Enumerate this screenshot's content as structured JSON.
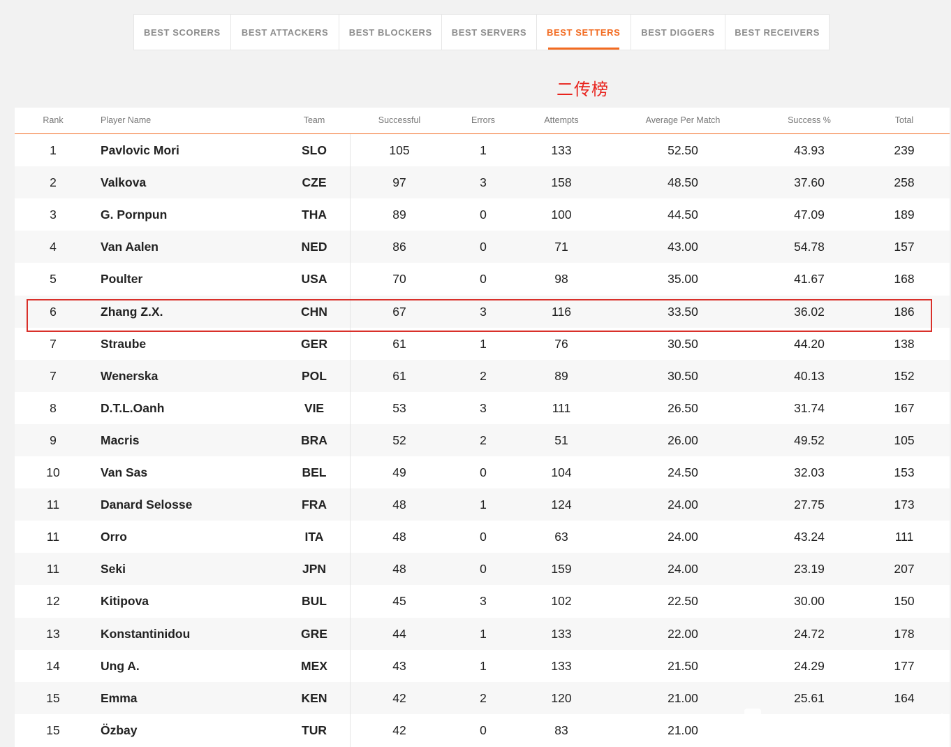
{
  "tabs": [
    {
      "label": "BEST SCORERS",
      "active": false
    },
    {
      "label": "BEST ATTACKERS",
      "active": false
    },
    {
      "label": "BEST BLOCKERS",
      "active": false
    },
    {
      "label": "BEST SERVERS",
      "active": false
    },
    {
      "label": "BEST SETTERS",
      "active": true
    },
    {
      "label": "BEST DIGGERS",
      "active": false
    },
    {
      "label": "BEST RECEIVERS",
      "active": false
    }
  ],
  "annotation": {
    "title": "二传榜",
    "highlighted_rank_row": "6",
    "highlight_color": "#d9302a"
  },
  "colors": {
    "accent": "#f26b21",
    "annotation_red": "#e8231d"
  },
  "table": {
    "headers": {
      "rank": "Rank",
      "name": "Player Name",
      "team": "Team",
      "successful": "Successful",
      "errors": "Errors",
      "attempts": "Attempts",
      "avg": "Average Per Match",
      "pct": "Success %",
      "total": "Total"
    },
    "rows": [
      {
        "rank": "1",
        "name": "Pavlovic Mori",
        "team": "SLO",
        "successful": "105",
        "errors": "1",
        "attempts": "133",
        "avg": "52.50",
        "pct": "43.93",
        "total": "239"
      },
      {
        "rank": "2",
        "name": "Valkova",
        "team": "CZE",
        "successful": "97",
        "errors": "3",
        "attempts": "158",
        "avg": "48.50",
        "pct": "37.60",
        "total": "258"
      },
      {
        "rank": "3",
        "name": "G. Pornpun",
        "team": "THA",
        "successful": "89",
        "errors": "0",
        "attempts": "100",
        "avg": "44.50",
        "pct": "47.09",
        "total": "189"
      },
      {
        "rank": "4",
        "name": "Van Aalen",
        "team": "NED",
        "successful": "86",
        "errors": "0",
        "attempts": "71",
        "avg": "43.00",
        "pct": "54.78",
        "total": "157"
      },
      {
        "rank": "5",
        "name": "Poulter",
        "team": "USA",
        "successful": "70",
        "errors": "0",
        "attempts": "98",
        "avg": "35.00",
        "pct": "41.67",
        "total": "168"
      },
      {
        "rank": "6",
        "name": "Zhang Z.X.",
        "team": "CHN",
        "successful": "67",
        "errors": "3",
        "attempts": "116",
        "avg": "33.50",
        "pct": "36.02",
        "total": "186"
      },
      {
        "rank": "7",
        "name": "Straube",
        "team": "GER",
        "successful": "61",
        "errors": "1",
        "attempts": "76",
        "avg": "30.50",
        "pct": "44.20",
        "total": "138"
      },
      {
        "rank": "7",
        "name": "Wenerska",
        "team": "POL",
        "successful": "61",
        "errors": "2",
        "attempts": "89",
        "avg": "30.50",
        "pct": "40.13",
        "total": "152"
      },
      {
        "rank": "8",
        "name": "D.T.L.Oanh",
        "team": "VIE",
        "successful": "53",
        "errors": "3",
        "attempts": "111",
        "avg": "26.50",
        "pct": "31.74",
        "total": "167"
      },
      {
        "rank": "9",
        "name": "Macris",
        "team": "BRA",
        "successful": "52",
        "errors": "2",
        "attempts": "51",
        "avg": "26.00",
        "pct": "49.52",
        "total": "105"
      },
      {
        "rank": "10",
        "name": "Van Sas",
        "team": "BEL",
        "successful": "49",
        "errors": "0",
        "attempts": "104",
        "avg": "24.50",
        "pct": "32.03",
        "total": "153"
      },
      {
        "rank": "11",
        "name": "Danard Selosse",
        "team": "FRA",
        "successful": "48",
        "errors": "1",
        "attempts": "124",
        "avg": "24.00",
        "pct": "27.75",
        "total": "173"
      },
      {
        "rank": "11",
        "name": "Orro",
        "team": "ITA",
        "successful": "48",
        "errors": "0",
        "attempts": "63",
        "avg": "24.00",
        "pct": "43.24",
        "total": "111"
      },
      {
        "rank": "11",
        "name": "Seki",
        "team": "JPN",
        "successful": "48",
        "errors": "0",
        "attempts": "159",
        "avg": "24.00",
        "pct": "23.19",
        "total": "207"
      },
      {
        "rank": "12",
        "name": "Kitipova",
        "team": "BUL",
        "successful": "45",
        "errors": "3",
        "attempts": "102",
        "avg": "22.50",
        "pct": "30.00",
        "total": "150"
      },
      {
        "rank": "13",
        "name": "Konstantinidou",
        "team": "GRE",
        "successful": "44",
        "errors": "1",
        "attempts": "133",
        "avg": "22.00",
        "pct": "24.72",
        "total": "178"
      },
      {
        "rank": "14",
        "name": "Ung A.",
        "team": "MEX",
        "successful": "43",
        "errors": "1",
        "attempts": "133",
        "avg": "21.50",
        "pct": "24.29",
        "total": "177"
      },
      {
        "rank": "15",
        "name": "Emma",
        "team": "KEN",
        "successful": "42",
        "errors": "2",
        "attempts": "120",
        "avg": "21.00",
        "pct": "25.61",
        "total": "164"
      },
      {
        "rank": "15",
        "name": "Özbay",
        "team": "TUR",
        "successful": "42",
        "errors": "0",
        "attempts": "83",
        "avg": "21.00",
        "pct": "",
        "total": ""
      }
    ]
  }
}
